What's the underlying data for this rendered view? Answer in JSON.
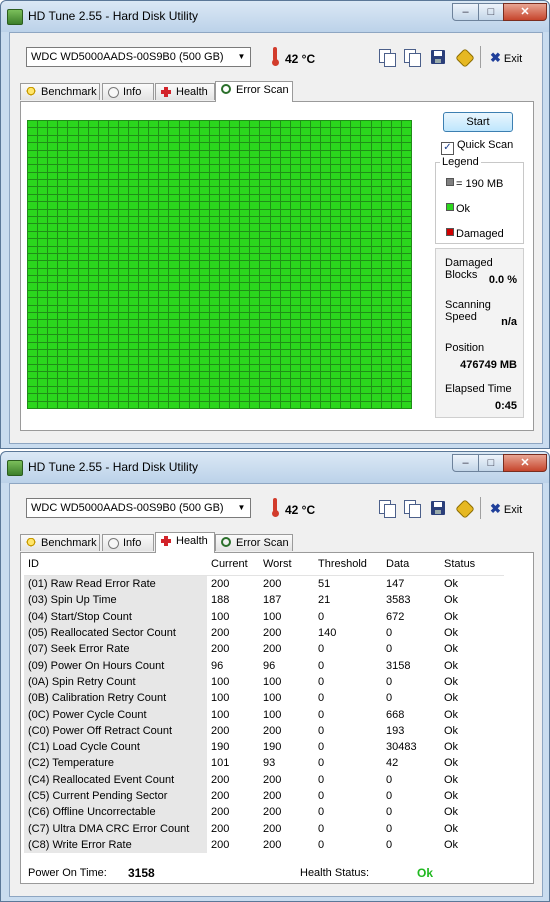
{
  "window_title": "HD Tune 2.55 - Hard Disk Utility",
  "drive": "WDC WD5000AADS-00S9B0 (500 GB)",
  "temperature": "42 °C",
  "exit_label": "Exit",
  "tabs": [
    "Benchmark",
    "Info",
    "Health",
    "Error Scan"
  ],
  "error_scan": {
    "start_label": "Start",
    "quick_scan_label": "Quick Scan",
    "quick_scan_checked": true,
    "legend_title": "Legend",
    "legend": [
      {
        "label": "= 190 MB",
        "color": "#808080"
      },
      {
        "label": "Ok",
        "color": "#2bd61d"
      },
      {
        "label": "Damaged",
        "color": "#d00000"
      }
    ],
    "damaged_blocks_label": "Damaged Blocks",
    "damaged_blocks": "0.0 %",
    "scanning_speed_label": "Scanning Speed",
    "scanning_speed": "n/a",
    "position_label": "Position",
    "position": "476749 MB",
    "elapsed_label": "Elapsed Time",
    "elapsed": "0:45"
  },
  "health": {
    "columns": [
      "ID",
      "Current",
      "Worst",
      "Threshold",
      "Data",
      "Status"
    ],
    "rows": [
      [
        "(01) Raw Read Error Rate",
        "200",
        "200",
        "51",
        "147",
        "Ok"
      ],
      [
        "(03) Spin Up Time",
        "188",
        "187",
        "21",
        "3583",
        "Ok"
      ],
      [
        "(04) Start/Stop Count",
        "100",
        "100",
        "0",
        "672",
        "Ok"
      ],
      [
        "(05) Reallocated Sector Count",
        "200",
        "200",
        "140",
        "0",
        "Ok"
      ],
      [
        "(07) Seek Error Rate",
        "200",
        "200",
        "0",
        "0",
        "Ok"
      ],
      [
        "(09) Power On Hours Count",
        "96",
        "96",
        "0",
        "3158",
        "Ok"
      ],
      [
        "(0A) Spin Retry Count",
        "100",
        "100",
        "0",
        "0",
        "Ok"
      ],
      [
        "(0B) Calibration Retry Count",
        "100",
        "100",
        "0",
        "0",
        "Ok"
      ],
      [
        "(0C) Power Cycle Count",
        "100",
        "100",
        "0",
        "668",
        "Ok"
      ],
      [
        "(C0) Power Off Retract Count",
        "200",
        "200",
        "0",
        "193",
        "Ok"
      ],
      [
        "(C1) Load Cycle Count",
        "190",
        "190",
        "0",
        "30483",
        "Ok"
      ],
      [
        "(C2) Temperature",
        "101",
        "93",
        "0",
        "42",
        "Ok"
      ],
      [
        "(C4) Reallocated Event Count",
        "200",
        "200",
        "0",
        "0",
        "Ok"
      ],
      [
        "(C5) Current Pending Sector",
        "200",
        "200",
        "0",
        "0",
        "Ok"
      ],
      [
        "(C6) Offline Uncorrectable",
        "200",
        "200",
        "0",
        "0",
        "Ok"
      ],
      [
        "(C7) Ultra DMA CRC Error Count",
        "200",
        "200",
        "0",
        "0",
        "Ok"
      ],
      [
        "(C8) Write Error Rate",
        "200",
        "200",
        "0",
        "0",
        "Ok"
      ]
    ],
    "power_on_time_label": "Power On Time:",
    "power_on_time": "3158",
    "health_status_label": "Health Status:",
    "health_status": "Ok"
  }
}
